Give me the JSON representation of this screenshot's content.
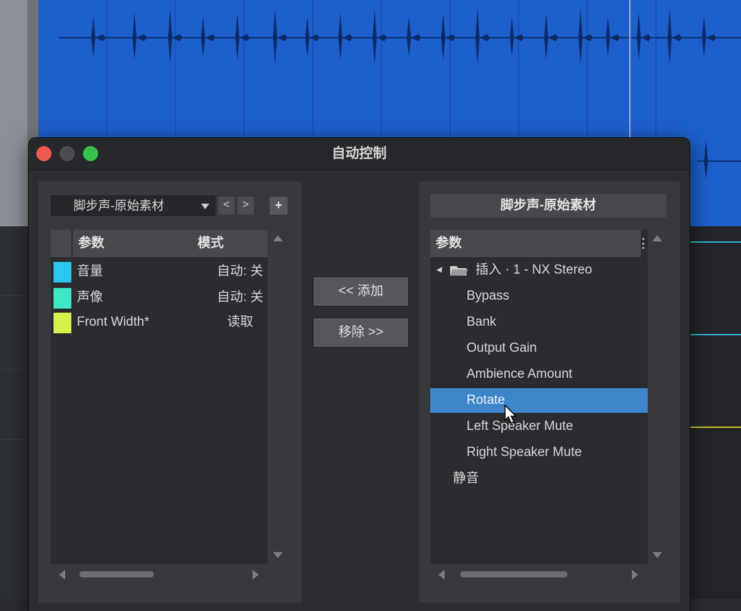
{
  "dialog": {
    "title": "自动控制"
  },
  "left_panel": {
    "source": "脚步声-原始素材",
    "prev_label": "<",
    "next_label": ">",
    "add_label": "+",
    "columns": [
      "参数",
      "模式"
    ],
    "rows": [
      {
        "name": "音量",
        "mode": "自动: 关",
        "color": "#2cc7ee"
      },
      {
        "name": "声像",
        "mode": "自动: 关",
        "color": "#3ee8c4"
      },
      {
        "name": "Front Width*",
        "mode": "读取",
        "color": "#d7f14a"
      }
    ]
  },
  "middle": {
    "add_button": "<< 添加",
    "remove_button": "移除 >>"
  },
  "right_panel": {
    "title": "脚步声-原始素材",
    "column": "参数",
    "folder": "插入 · 1 - NX Stereo",
    "items": [
      "Bypass",
      "Bank",
      "Output Gain",
      "Ambience Amount",
      "Rotate",
      "Left Speaker Mute",
      "Right Speaker Mute"
    ],
    "selected": "Rotate",
    "root_item": "静音"
  },
  "colors": {
    "clip": "#1d5fcb",
    "selection": "#3c85c9"
  }
}
